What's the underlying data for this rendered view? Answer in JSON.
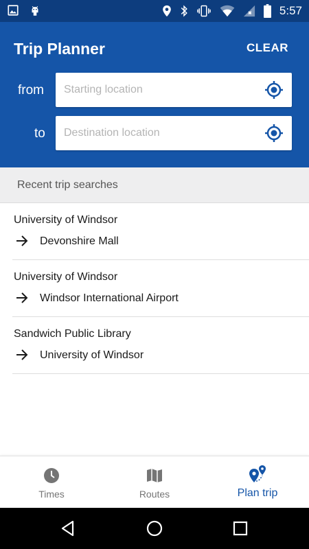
{
  "status_bar": {
    "time": "5:57",
    "icons": [
      "image-icon",
      "android-icon",
      "location-icon",
      "bluetooth-icon",
      "vibrate-icon",
      "wifi-icon",
      "signal-icon",
      "battery-icon"
    ]
  },
  "header": {
    "title": "Trip Planner",
    "clear_label": "CLEAR",
    "from_label": "from",
    "to_label": "to",
    "from_placeholder": "Starting location",
    "to_placeholder": "Destination location",
    "from_value": "",
    "to_value": "",
    "accent_color": "#1555a8"
  },
  "recent": {
    "heading": "Recent trip searches",
    "trips": [
      {
        "from": "University of Windsor",
        "to": "Devonshire Mall"
      },
      {
        "from": "University of Windsor",
        "to": "Windsor International Airport"
      },
      {
        "from": "Sandwich Public Library",
        "to": "University of Windsor"
      }
    ]
  },
  "bottom_nav": {
    "items": [
      {
        "label": "Times",
        "icon": "clock-icon",
        "active": false
      },
      {
        "label": "Routes",
        "icon": "map-icon",
        "active": false
      },
      {
        "label": "Plan trip",
        "icon": "plan-trip-icon",
        "active": true
      }
    ]
  },
  "system_nav": {
    "buttons": [
      "back-icon",
      "home-icon",
      "recents-icon"
    ]
  }
}
